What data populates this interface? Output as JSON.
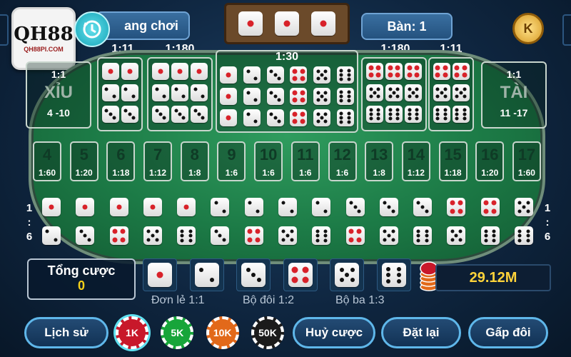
{
  "logo": {
    "mark": "QH88",
    "sub": "QH88PI.COM"
  },
  "header": {
    "mode_label": "ang chơi",
    "table_label": "Bàn: 1",
    "coin_label": "K"
  },
  "tray_dice": [
    1,
    1,
    1
  ],
  "odds_top": {
    "pairs_left": "1:11",
    "triple_left": "1:180",
    "any_triple": "1:30",
    "triple_right": "1:180",
    "pairs_right": "1:11"
  },
  "xiu": {
    "odds": "1:1",
    "name": "XỈU",
    "range": "4 -10"
  },
  "tai": {
    "odds": "1:1",
    "name": "TÀI",
    "range": "11 -17"
  },
  "sums": [
    {
      "n": "4",
      "o": "1:60"
    },
    {
      "n": "5",
      "o": "1:20"
    },
    {
      "n": "6",
      "o": "1:18"
    },
    {
      "n": "7",
      "o": "1:12"
    },
    {
      "n": "8",
      "o": "1:8"
    },
    {
      "n": "9",
      "o": "1:6"
    },
    {
      "n": "10",
      "o": "1:6"
    },
    {
      "n": "11",
      "o": "1:6"
    },
    {
      "n": "12",
      "o": "1:6"
    },
    {
      "n": "13",
      "o": "1:8"
    },
    {
      "n": "14",
      "o": "1:12"
    },
    {
      "n": "15",
      "o": "1:18"
    },
    {
      "n": "16",
      "o": "1:20"
    },
    {
      "n": "17",
      "o": "1:60"
    }
  ],
  "combo_odds": {
    "left": [
      "1",
      ":",
      "6"
    ],
    "right": [
      "1",
      ":",
      "6"
    ]
  },
  "combos": [
    [
      1,
      2
    ],
    [
      1,
      3
    ],
    [
      1,
      4
    ],
    [
      1,
      5
    ],
    [
      1,
      6
    ],
    [
      2,
      3
    ],
    [
      2,
      4
    ],
    [
      2,
      5
    ],
    [
      2,
      6
    ],
    [
      3,
      4
    ],
    [
      3,
      5
    ],
    [
      3,
      6
    ],
    [
      4,
      5
    ],
    [
      4,
      6
    ],
    [
      5,
      6
    ]
  ],
  "single_dice": [
    1,
    2,
    3,
    4,
    5,
    6
  ],
  "single_labels": {
    "single": "Đơn lẻ 1:1",
    "double": "Bộ đôi 1:2",
    "triple": "Bộ ba 1:3"
  },
  "total_bet": {
    "label": "Tổng cược",
    "value": "0"
  },
  "balance": "29.12M",
  "buttons": {
    "history": "Lịch sử",
    "cancel": "Huỷ cược",
    "reset": "Đặt lại",
    "double": "Gấp đôi"
  },
  "chips": [
    {
      "label": "1K",
      "color": "#c8182a"
    },
    {
      "label": "5K",
      "color": "#17a53a"
    },
    {
      "label": "10K",
      "color": "#e2691a"
    },
    {
      "label": "50K",
      "color": "#1b1b1b"
    }
  ]
}
